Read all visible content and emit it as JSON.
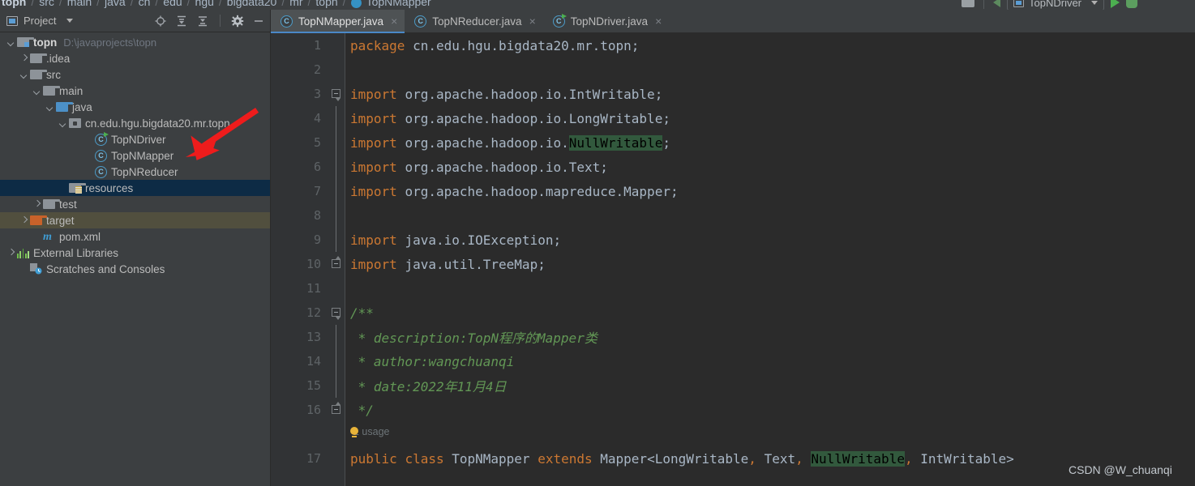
{
  "breadcrumb": {
    "items": [
      "topn",
      "src",
      "main",
      "java",
      "cn",
      "edu",
      "hgu",
      "bigdata20",
      "mr",
      "topn"
    ],
    "current": "TopNMapper",
    "separator": "/"
  },
  "run_config": {
    "name": "TopNDriver",
    "run_label": "Run",
    "debug_label": "Debug",
    "build_label": "Build"
  },
  "project_panel": {
    "title": "Project",
    "tools": [
      {
        "name": "locate-icon",
        "label": "Select Opened File"
      },
      {
        "name": "expand-all-icon",
        "label": "Expand All"
      },
      {
        "name": "collapse-all-icon",
        "label": "Collapse All"
      },
      {
        "name": "gear-icon",
        "label": "Settings"
      },
      {
        "name": "minimize-icon",
        "label": "Hide"
      }
    ],
    "tree": [
      {
        "label": "topn",
        "path": "D:\\javaprojects\\topn",
        "indent": 0,
        "arrow": "down",
        "icon": "module-folder",
        "bold": true,
        "state": "normal"
      },
      {
        "label": ".idea",
        "path": "",
        "indent": 1,
        "arrow": "right",
        "icon": "folder",
        "bold": false,
        "state": "normal"
      },
      {
        "label": "src",
        "path": "",
        "indent": 1,
        "arrow": "down",
        "icon": "folder",
        "bold": false,
        "state": "normal"
      },
      {
        "label": "main",
        "path": "",
        "indent": 2,
        "arrow": "down",
        "icon": "folder",
        "bold": false,
        "state": "normal"
      },
      {
        "label": "java",
        "path": "",
        "indent": 3,
        "arrow": "down",
        "icon": "folder-blue",
        "bold": false,
        "state": "normal"
      },
      {
        "label": "cn.edu.hgu.bigdata20.mr.topn",
        "path": "",
        "indent": 4,
        "arrow": "down",
        "icon": "package",
        "bold": false,
        "state": "normal"
      },
      {
        "label": "TopNDriver",
        "path": "",
        "indent": 6,
        "arrow": "none",
        "icon": "class-runnable",
        "bold": false,
        "state": "normal"
      },
      {
        "label": "TopNMapper",
        "path": "",
        "indent": 6,
        "arrow": "none",
        "icon": "class",
        "bold": false,
        "state": "normal"
      },
      {
        "label": "TopNReducer",
        "path": "",
        "indent": 6,
        "arrow": "none",
        "icon": "class",
        "bold": false,
        "state": "normal"
      },
      {
        "label": "resources",
        "path": "",
        "indent": 4,
        "arrow": "none",
        "icon": "folder-resources",
        "bold": false,
        "state": "selected"
      },
      {
        "label": "test",
        "path": "",
        "indent": 2,
        "arrow": "right",
        "icon": "folder",
        "bold": false,
        "state": "normal"
      },
      {
        "label": "target",
        "path": "",
        "indent": 1,
        "arrow": "right",
        "icon": "folder-orange",
        "bold": false,
        "state": "hovered"
      },
      {
        "label": "pom.xml",
        "path": "",
        "indent": 2,
        "arrow": "none",
        "icon": "maven",
        "bold": false,
        "state": "normal"
      },
      {
        "label": "External Libraries",
        "path": "",
        "indent": 0,
        "arrow": "right",
        "icon": "library",
        "bold": false,
        "state": "normal"
      },
      {
        "label": "Scratches and Consoles",
        "path": "",
        "indent": 1,
        "arrow": "none",
        "icon": "scratches",
        "bold": false,
        "state": "normal"
      }
    ]
  },
  "editor": {
    "tabs": [
      {
        "label": "TopNMapper.java",
        "icon": "class",
        "active": true,
        "close": "×"
      },
      {
        "label": "TopNReducer.java",
        "icon": "class",
        "active": false,
        "close": "×"
      },
      {
        "label": "TopNDriver.java",
        "icon": "class-runnable",
        "active": false,
        "close": "×"
      }
    ],
    "inlay_hint": "1 usage",
    "lines": [
      {
        "num": "1",
        "fold": "none",
        "tokens": [
          {
            "t": "package ",
            "c": "kw"
          },
          {
            "t": "cn.edu.hgu.bigdata20.mr.topn;",
            "c": "txt"
          }
        ]
      },
      {
        "num": "2",
        "fold": "none",
        "tokens": []
      },
      {
        "num": "3",
        "fold": "open",
        "tokens": [
          {
            "t": "import ",
            "c": "kw"
          },
          {
            "t": "org.apache.hadoop.io.IntWritable;",
            "c": "txt"
          }
        ]
      },
      {
        "num": "4",
        "fold": "bar",
        "tokens": [
          {
            "t": "import ",
            "c": "kw"
          },
          {
            "t": "org.apache.hadoop.io.LongWritable;",
            "c": "txt"
          }
        ]
      },
      {
        "num": "5",
        "fold": "bar",
        "tokens": [
          {
            "t": "import ",
            "c": "kw"
          },
          {
            "t": "org.apache.hadoop.io.",
            "c": "txt"
          },
          {
            "t": "NullWritable",
            "c": "hl"
          },
          {
            "t": ";",
            "c": "txt"
          }
        ]
      },
      {
        "num": "6",
        "fold": "bar",
        "tokens": [
          {
            "t": "import ",
            "c": "kw"
          },
          {
            "t": "org.apache.hadoop.io.Text;",
            "c": "txt"
          }
        ]
      },
      {
        "num": "7",
        "fold": "bar",
        "tokens": [
          {
            "t": "import ",
            "c": "kw"
          },
          {
            "t": "org.apache.hadoop.mapreduce.Mapper;",
            "c": "txt"
          }
        ]
      },
      {
        "num": "8",
        "fold": "bar",
        "tokens": []
      },
      {
        "num": "9",
        "fold": "bar",
        "tokens": [
          {
            "t": "import ",
            "c": "kw"
          },
          {
            "t": "java.io.IOException;",
            "c": "txt"
          }
        ]
      },
      {
        "num": "10",
        "fold": "close",
        "tokens": [
          {
            "t": "import ",
            "c": "kw"
          },
          {
            "t": "java.util.TreeMap;",
            "c": "txt"
          }
        ]
      },
      {
        "num": "11",
        "fold": "none",
        "tokens": []
      },
      {
        "num": "12",
        "fold": "open",
        "tokens": [
          {
            "t": "/**",
            "c": "cmt"
          }
        ]
      },
      {
        "num": "13",
        "fold": "bar",
        "tokens": [
          {
            "t": " * description:TopN程序的Mapper类",
            "c": "cmt"
          }
        ]
      },
      {
        "num": "14",
        "fold": "bar",
        "tokens": [
          {
            "t": " * author:wangchuanqi",
            "c": "cmt"
          }
        ]
      },
      {
        "num": "15",
        "fold": "bar",
        "tokens": [
          {
            "t": " * date:2022年11月4日",
            "c": "cmt"
          }
        ]
      },
      {
        "num": "16",
        "fold": "close",
        "tokens": [
          {
            "t": " */",
            "c": "cmt"
          }
        ]
      },
      {
        "num": "",
        "fold": "none",
        "inlay": true,
        "tokens": []
      },
      {
        "num": "17",
        "fold": "none",
        "tokens": [
          {
            "t": "public ",
            "c": "kw"
          },
          {
            "t": "class ",
            "c": "kw"
          },
          {
            "t": "TopNMapper ",
            "c": "cls"
          },
          {
            "t": "extends ",
            "c": "kw"
          },
          {
            "t": "Mapper<LongWritable",
            "c": "txt"
          },
          {
            "t": ", ",
            "c": "kw"
          },
          {
            "t": "Text",
            "c": "txt"
          },
          {
            "t": ", ",
            "c": "kw"
          },
          {
            "t": "NullWritable",
            "c": "hl"
          },
          {
            "t": ", ",
            "c": "kw"
          },
          {
            "t": "IntWritable>",
            "c": "txt"
          }
        ]
      }
    ]
  },
  "watermark": "CSDN @W_chuanqi",
  "colors": {
    "panel_bg": "#3c3f41",
    "editor_bg": "#2b2b2b",
    "gutter_bg": "#313335",
    "selection": "#0d2b45",
    "hover": "#514f3e",
    "keyword": "#cc7832",
    "comment": "#629755",
    "text": "#a9b7c6",
    "accent": "#4a88c7",
    "annotation_arrow": "#ee1c1c"
  }
}
